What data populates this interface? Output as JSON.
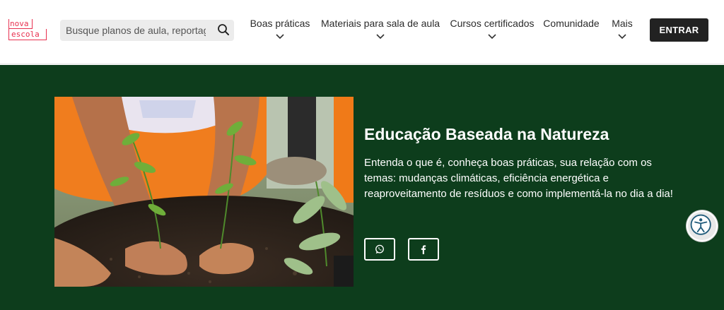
{
  "logo": {
    "line1": "nova",
    "line2": "escola"
  },
  "search": {
    "placeholder": "Busque planos de aula, reportagens"
  },
  "nav": {
    "items": [
      {
        "label": "Boas práticas",
        "has_dropdown": true
      },
      {
        "label": "Materiais para sala de aula",
        "has_dropdown": true
      },
      {
        "label": "Cursos certificados",
        "has_dropdown": true
      },
      {
        "label": "Comunidade",
        "has_dropdown": false
      },
      {
        "label": "Mais",
        "has_dropdown": true
      }
    ],
    "login_label": "ENTRAR"
  },
  "hero": {
    "title": "Educação Baseada na Natureza",
    "description": "Entenda o que é, conheça boas práticas, sua relação com os temas: mudanças climáticas, eficiência energética e reaproveitamento de resíduos e como implementá-la no dia a dia!",
    "share": [
      {
        "network": "whatsapp",
        "icon": "whatsapp-icon"
      },
      {
        "network": "facebook",
        "icon": "facebook-icon"
      }
    ]
  },
  "colors": {
    "brand": "#e8304f",
    "hero_bg": "#0d3d1c",
    "button_dark": "#222222",
    "search_bg": "#ececec"
  }
}
